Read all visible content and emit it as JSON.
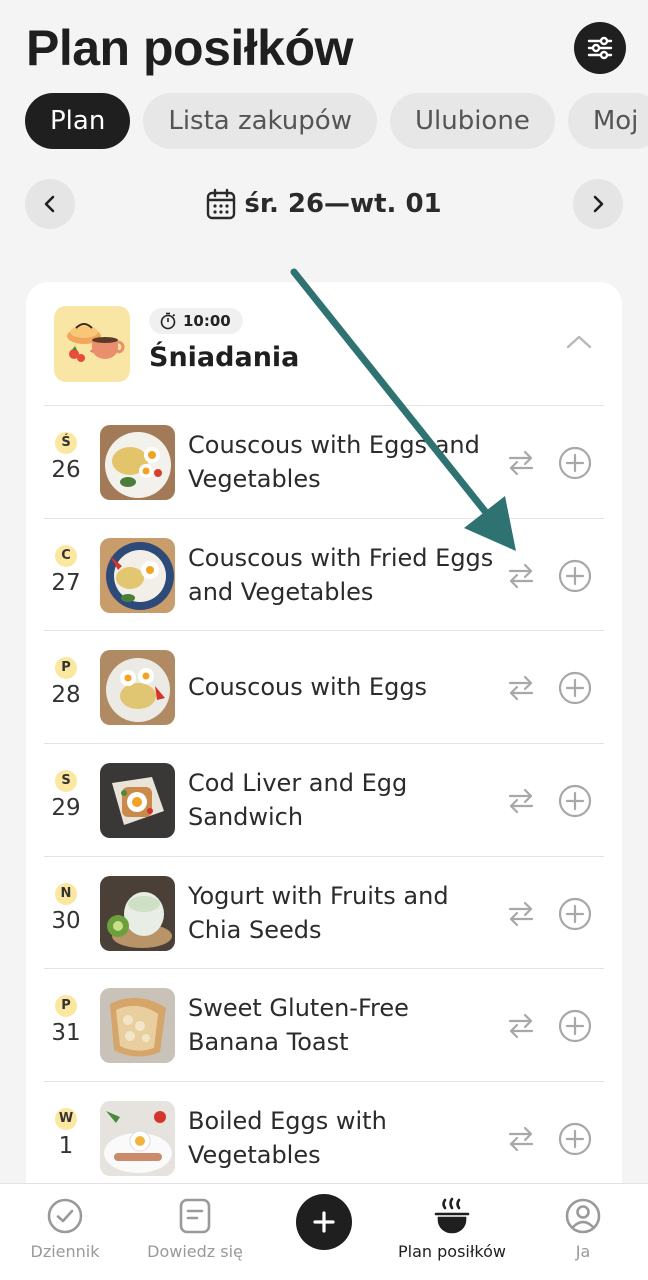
{
  "header": {
    "title": "Plan posiłków",
    "filter_icon": "sliders-icon"
  },
  "tabs": [
    {
      "label": "Plan",
      "active": true
    },
    {
      "label": "Lista zakupów",
      "active": false
    },
    {
      "label": "Ulubione",
      "active": false
    },
    {
      "label": "Moj",
      "active": false
    }
  ],
  "date_range": {
    "label": "śr. 26—wt. 01",
    "icon": "calendar-icon"
  },
  "meal": {
    "time": "10:00",
    "name": "Śniadania",
    "time_icon": "stopwatch-icon"
  },
  "days": [
    {
      "letter": "Ś",
      "num": "26",
      "name": "Couscous with Eggs and Vegetables"
    },
    {
      "letter": "C",
      "num": "27",
      "name": "Couscous with Fried Eggs and Vegetables"
    },
    {
      "letter": "P",
      "num": "28",
      "name": "Couscous with Eggs"
    },
    {
      "letter": "S",
      "num": "29",
      "name": "Cod Liver and Egg Sandwich"
    },
    {
      "letter": "N",
      "num": "30",
      "name": "Yogurt with Fruits and Chia Seeds"
    },
    {
      "letter": "P",
      "num": "31",
      "name": "Sweet Gluten-Free Banana Toast"
    },
    {
      "letter": "W",
      "num": "1",
      "name": "Boiled Eggs with Vegetables"
    }
  ],
  "bottom_nav": [
    {
      "label": "Dziennik",
      "icon": "check-circle-icon"
    },
    {
      "label": "Dowiedz się",
      "icon": "note-icon"
    },
    {
      "label": "",
      "icon": "plus-icon"
    },
    {
      "label": "Plan posiłków",
      "icon": "cooking-pot-icon",
      "active": true
    },
    {
      "label": "Ja",
      "icon": "user-circle-icon"
    }
  ],
  "colors": {
    "dark": "#1f1f1f",
    "accent_arrow": "#2e7372",
    "day_badge": "#fbe7a0",
    "meal_thumb": "#f9e6a4"
  }
}
